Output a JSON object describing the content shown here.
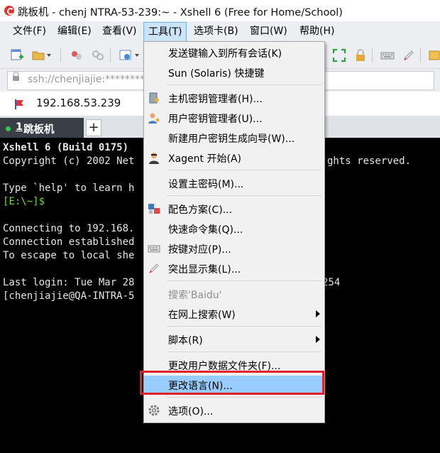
{
  "window": {
    "title": "跳板机 - chenj        NTRA-53-239:~ - Xshell 6 (Free for Home/School)"
  },
  "menubar": {
    "items": [
      "文件(F)",
      "编辑(E)",
      "查看(V)",
      "工具(T)",
      "选项卡(B)",
      "窗口(W)",
      "帮助(H)"
    ]
  },
  "address": {
    "text": "ssh://chenjiajie:********"
  },
  "session": {
    "host": "192.168.53.239"
  },
  "tab": {
    "num": "1",
    "label": "跳板机",
    "add": "+"
  },
  "terminal": {
    "lines": [
      "Xshell 6 (Build 0175)",
      "Copyright (c) 2002 Net",
      "ghts reserved.",
      "Type `help' to learn h",
      "[E:\\~]$",
      "Connecting to 192.168.",
      "Connection established",
      "To escape to local she",
      "Last login: Tue Mar 28",
      "254",
      "[chenjiajie@QA-INTRA-5"
    ]
  },
  "tools_menu": {
    "items": [
      "发送键输入到所有会话(K)",
      "Sun (Solaris) 快捷键",
      "主机密钥管理者(H)...",
      "用户密钥管理者(U)...",
      "新建用户密钥生成向导(W)...",
      "Xagent 开始(A)",
      "设置主密码(M)...",
      "配色方案(C)...",
      "快速命令集(Q)...",
      "按键对应(P)...",
      "突出显示集(L)...",
      "搜索'Baidu'",
      "在网上搜索(W)",
      "脚本(R)",
      "更改用户数据文件夹(F)...",
      "更改语言(N)...",
      "选项(O)..."
    ],
    "highlighted_item": "更改语言(N)..."
  },
  "colors": {
    "terminal_bg": "#000000",
    "prompt_green": "#6fde2f",
    "highlight": "#99ccff",
    "annotation_red": "#e0202f"
  }
}
